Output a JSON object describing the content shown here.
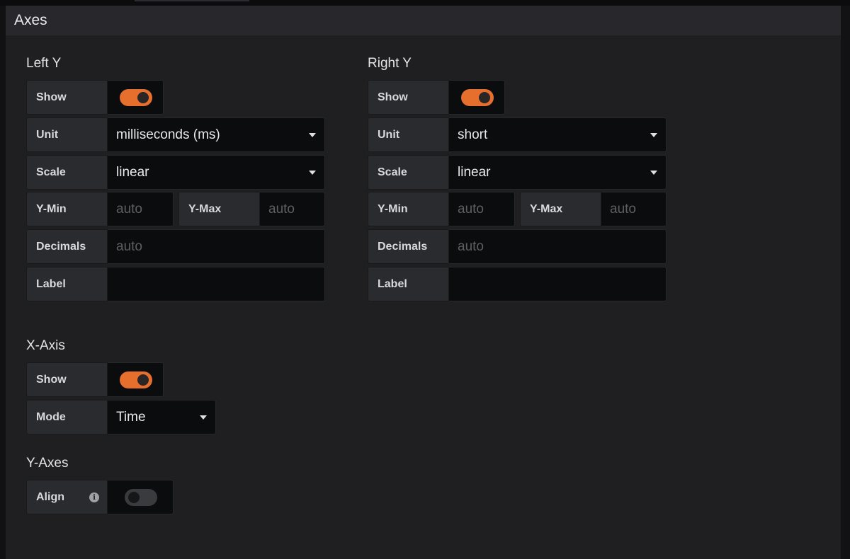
{
  "panel": {
    "title": "Axes"
  },
  "left_y": {
    "title": "Left Y",
    "show_label": "Show",
    "show": true,
    "unit_label": "Unit",
    "unit_value": "milliseconds (ms)",
    "scale_label": "Scale",
    "scale_value": "linear",
    "ymin_label": "Y-Min",
    "ymin_placeholder": "auto",
    "ymax_label": "Y-Max",
    "ymax_placeholder": "auto",
    "decimals_label": "Decimals",
    "decimals_placeholder": "auto",
    "label_label": "Label",
    "label_value": ""
  },
  "right_y": {
    "title": "Right Y",
    "show_label": "Show",
    "show": true,
    "unit_label": "Unit",
    "unit_value": "short",
    "scale_label": "Scale",
    "scale_value": "linear",
    "ymin_label": "Y-Min",
    "ymin_placeholder": "auto",
    "ymax_label": "Y-Max",
    "ymax_placeholder": "auto",
    "decimals_label": "Decimals",
    "decimals_placeholder": "auto",
    "label_label": "Label",
    "label_value": ""
  },
  "x_axis": {
    "title": "X-Axis",
    "show_label": "Show",
    "show": true,
    "mode_label": "Mode",
    "mode_value": "Time"
  },
  "y_axes": {
    "title": "Y-Axes",
    "align_label": "Align",
    "align": false,
    "info_icon": "info-icon"
  },
  "colors": {
    "toggle_on": "#e66f2e",
    "panel_bg": "#1f1f22",
    "input_bg": "#0b0c0e"
  }
}
